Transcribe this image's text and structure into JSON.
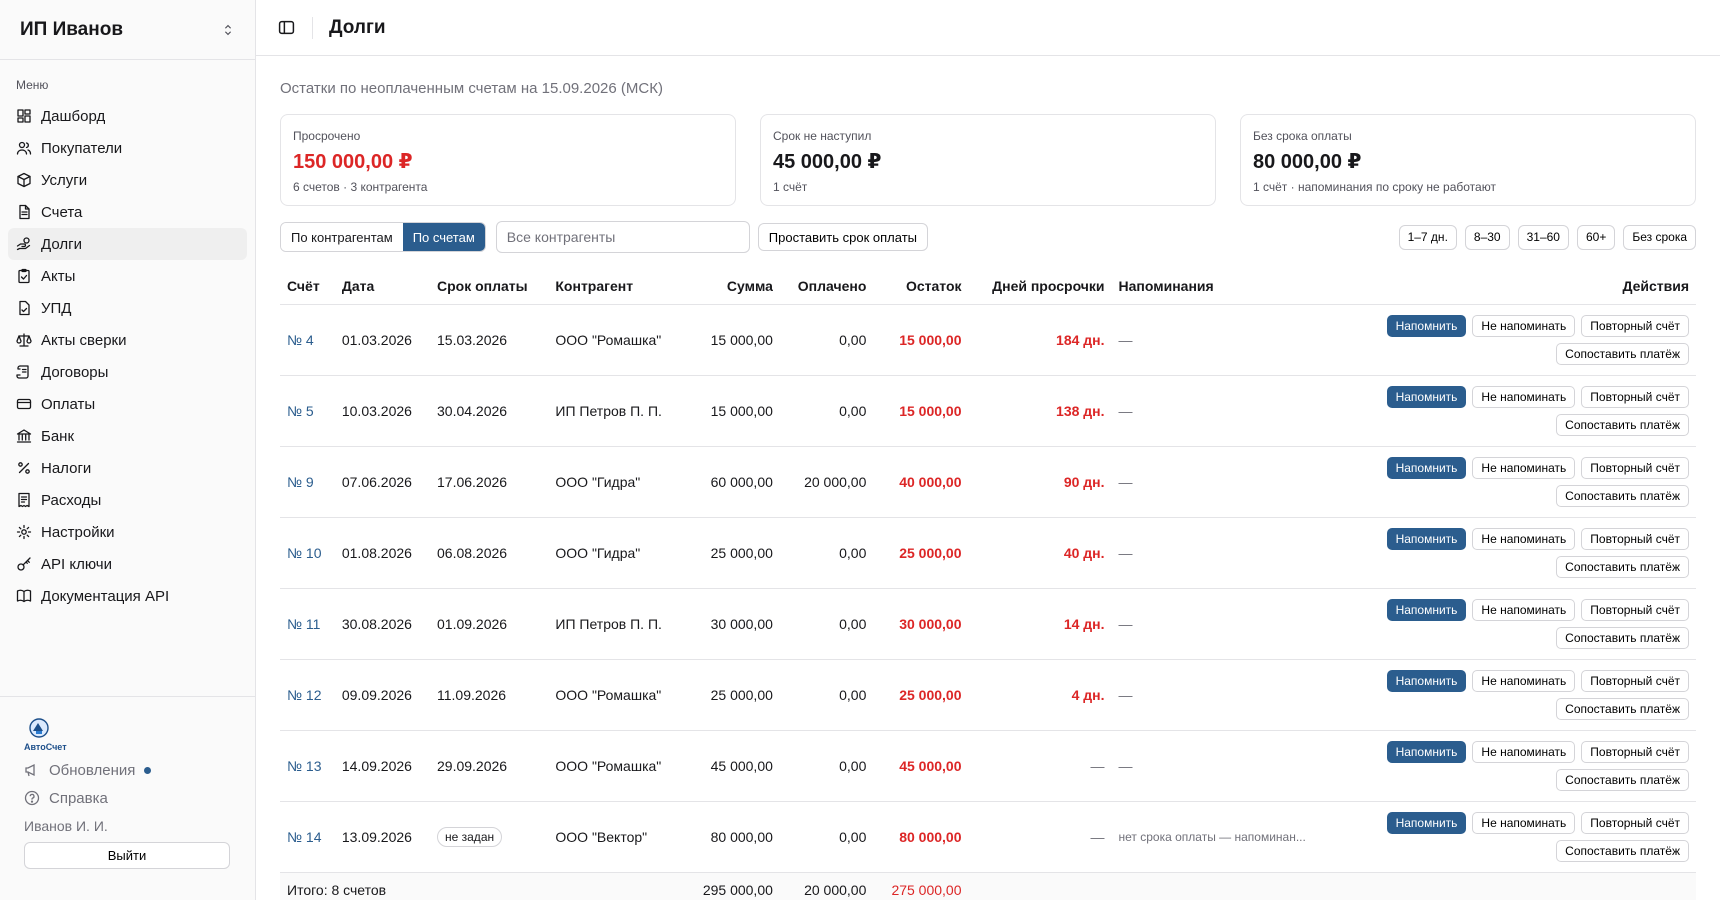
{
  "sidebar": {
    "org_name": "ИП Иванов",
    "menu_title": "Меню",
    "items": [
      {
        "label": "Дашборд",
        "icon": "dashboard-icon"
      },
      {
        "label": "Покупатели",
        "icon": "users-icon"
      },
      {
        "label": "Услуги",
        "icon": "box-icon"
      },
      {
        "label": "Счета",
        "icon": "file-icon"
      },
      {
        "label": "Долги",
        "icon": "hand-coins-icon"
      },
      {
        "label": "Акты",
        "icon": "clipboard-check-icon"
      },
      {
        "label": "УПД",
        "icon": "file-check-icon"
      },
      {
        "label": "Акты сверки",
        "icon": "scale-icon"
      },
      {
        "label": "Договоры",
        "icon": "scroll-icon"
      },
      {
        "label": "Оплаты",
        "icon": "credit-card-icon"
      },
      {
        "label": "Банк",
        "icon": "bank-icon"
      },
      {
        "label": "Налоги",
        "icon": "percent-icon"
      },
      {
        "label": "Расходы",
        "icon": "receipt-icon"
      },
      {
        "label": "Настройки",
        "icon": "gear-icon"
      },
      {
        "label": "API ключи",
        "icon": "key-icon"
      },
      {
        "label": "Документация API",
        "icon": "book-icon"
      }
    ],
    "active_index": 4,
    "logo_text": "АвтоСчет",
    "updates_label": "Обновления",
    "help_label": "Справка",
    "user_name": "Иванов И. И.",
    "logout_label": "Выйти"
  },
  "header": {
    "title": "Долги"
  },
  "subtitle": "Остатки по неоплаченным счетам на 15.09.2026 (МСК)",
  "cards": [
    {
      "label": "Просрочено",
      "value": "150 000,00 ₽",
      "note": "6 счетов · 3 контрагента",
      "accent": "#dc2626"
    },
    {
      "label": "Срок не наступил",
      "value": "45 000,00 ₽",
      "note": "1 счёт"
    },
    {
      "label": "Без срока оплаты",
      "value": "80 000,00 ₽",
      "note": "1 счёт · напоминания по сроку не работают"
    }
  ],
  "toolbar": {
    "view_by_counterparty": "По контрагентам",
    "view_by_invoice": "По счетам",
    "filter_placeholder": "Все контрагенты",
    "set_due_label": "Проставить срок оплаты",
    "buckets": [
      "1–7 дн.",
      "8–30",
      "31–60",
      "60+",
      "Без срока"
    ]
  },
  "table": {
    "headers": {
      "invoice": "Счёт",
      "date": "Дата",
      "due": "Срок оплаты",
      "counterparty": "Контрагент",
      "amount": "Сумма",
      "paid": "Оплачено",
      "balance": "Остаток",
      "overdue_days": "Дней просрочки",
      "reminders": "Напоминания",
      "actions": "Действия"
    },
    "action_labels": {
      "remind": "Напомнить",
      "no_remind": "Не напоминать",
      "repeat": "Повторный счёт",
      "match": "Сопоставить платёж"
    },
    "rows": [
      {
        "invoice": "№ 4",
        "date": "01.03.2026",
        "due": "15.03.2026",
        "counterparty": "ООО \"Ромашка\"",
        "amount": "15 000,00",
        "paid": "0,00",
        "balance": "15 000,00",
        "overdue": "184 дн.",
        "reminders": "—"
      },
      {
        "invoice": "№ 5",
        "date": "10.03.2026",
        "due": "30.04.2026",
        "counterparty": "ИП Петров П. П.",
        "amount": "15 000,00",
        "paid": "0,00",
        "balance": "15 000,00",
        "overdue": "138 дн.",
        "reminders": "—"
      },
      {
        "invoice": "№ 9",
        "date": "07.06.2026",
        "due": "17.06.2026",
        "counterparty": "ООО \"Гидра\"",
        "amount": "60 000,00",
        "paid": "20 000,00",
        "balance": "40 000,00",
        "overdue": "90 дн.",
        "reminders": "—"
      },
      {
        "invoice": "№ 10",
        "date": "01.08.2026",
        "due": "06.08.2026",
        "counterparty": "ООО \"Гидра\"",
        "amount": "25 000,00",
        "paid": "0,00",
        "balance": "25 000,00",
        "overdue": "40 дн.",
        "reminders": "—"
      },
      {
        "invoice": "№ 11",
        "date": "30.08.2026",
        "due": "01.09.2026",
        "counterparty": "ИП Петров П. П.",
        "amount": "30 000,00",
        "paid": "0,00",
        "balance": "30 000,00",
        "overdue": "14 дн.",
        "reminders": "—"
      },
      {
        "invoice": "№ 12",
        "date": "09.09.2026",
        "due": "11.09.2026",
        "counterparty": "ООО \"Ромашка\"",
        "amount": "25 000,00",
        "paid": "0,00",
        "balance": "25 000,00",
        "overdue": "4 дн.",
        "reminders": "—"
      },
      {
        "invoice": "№ 13",
        "date": "14.09.2026",
        "due": "29.09.2026",
        "counterparty": "ООО \"Ромашка\"",
        "amount": "45 000,00",
        "paid": "0,00",
        "balance": "45 000,00",
        "overdue": "—",
        "reminders": "—"
      },
      {
        "invoice": "№ 14",
        "date": "13.09.2026",
        "due": "не задан",
        "due_badge": true,
        "counterparty": "ООО \"Вектор\"",
        "amount": "80 000,00",
        "paid": "0,00",
        "balance": "80 000,00",
        "overdue": "—",
        "reminders": "нет срока оплаты — напоминан..."
      }
    ],
    "total": {
      "label": "Итого: 8 счетов",
      "amount": "295 000,00",
      "paid": "20 000,00",
      "balance": "275 000,00"
    }
  }
}
